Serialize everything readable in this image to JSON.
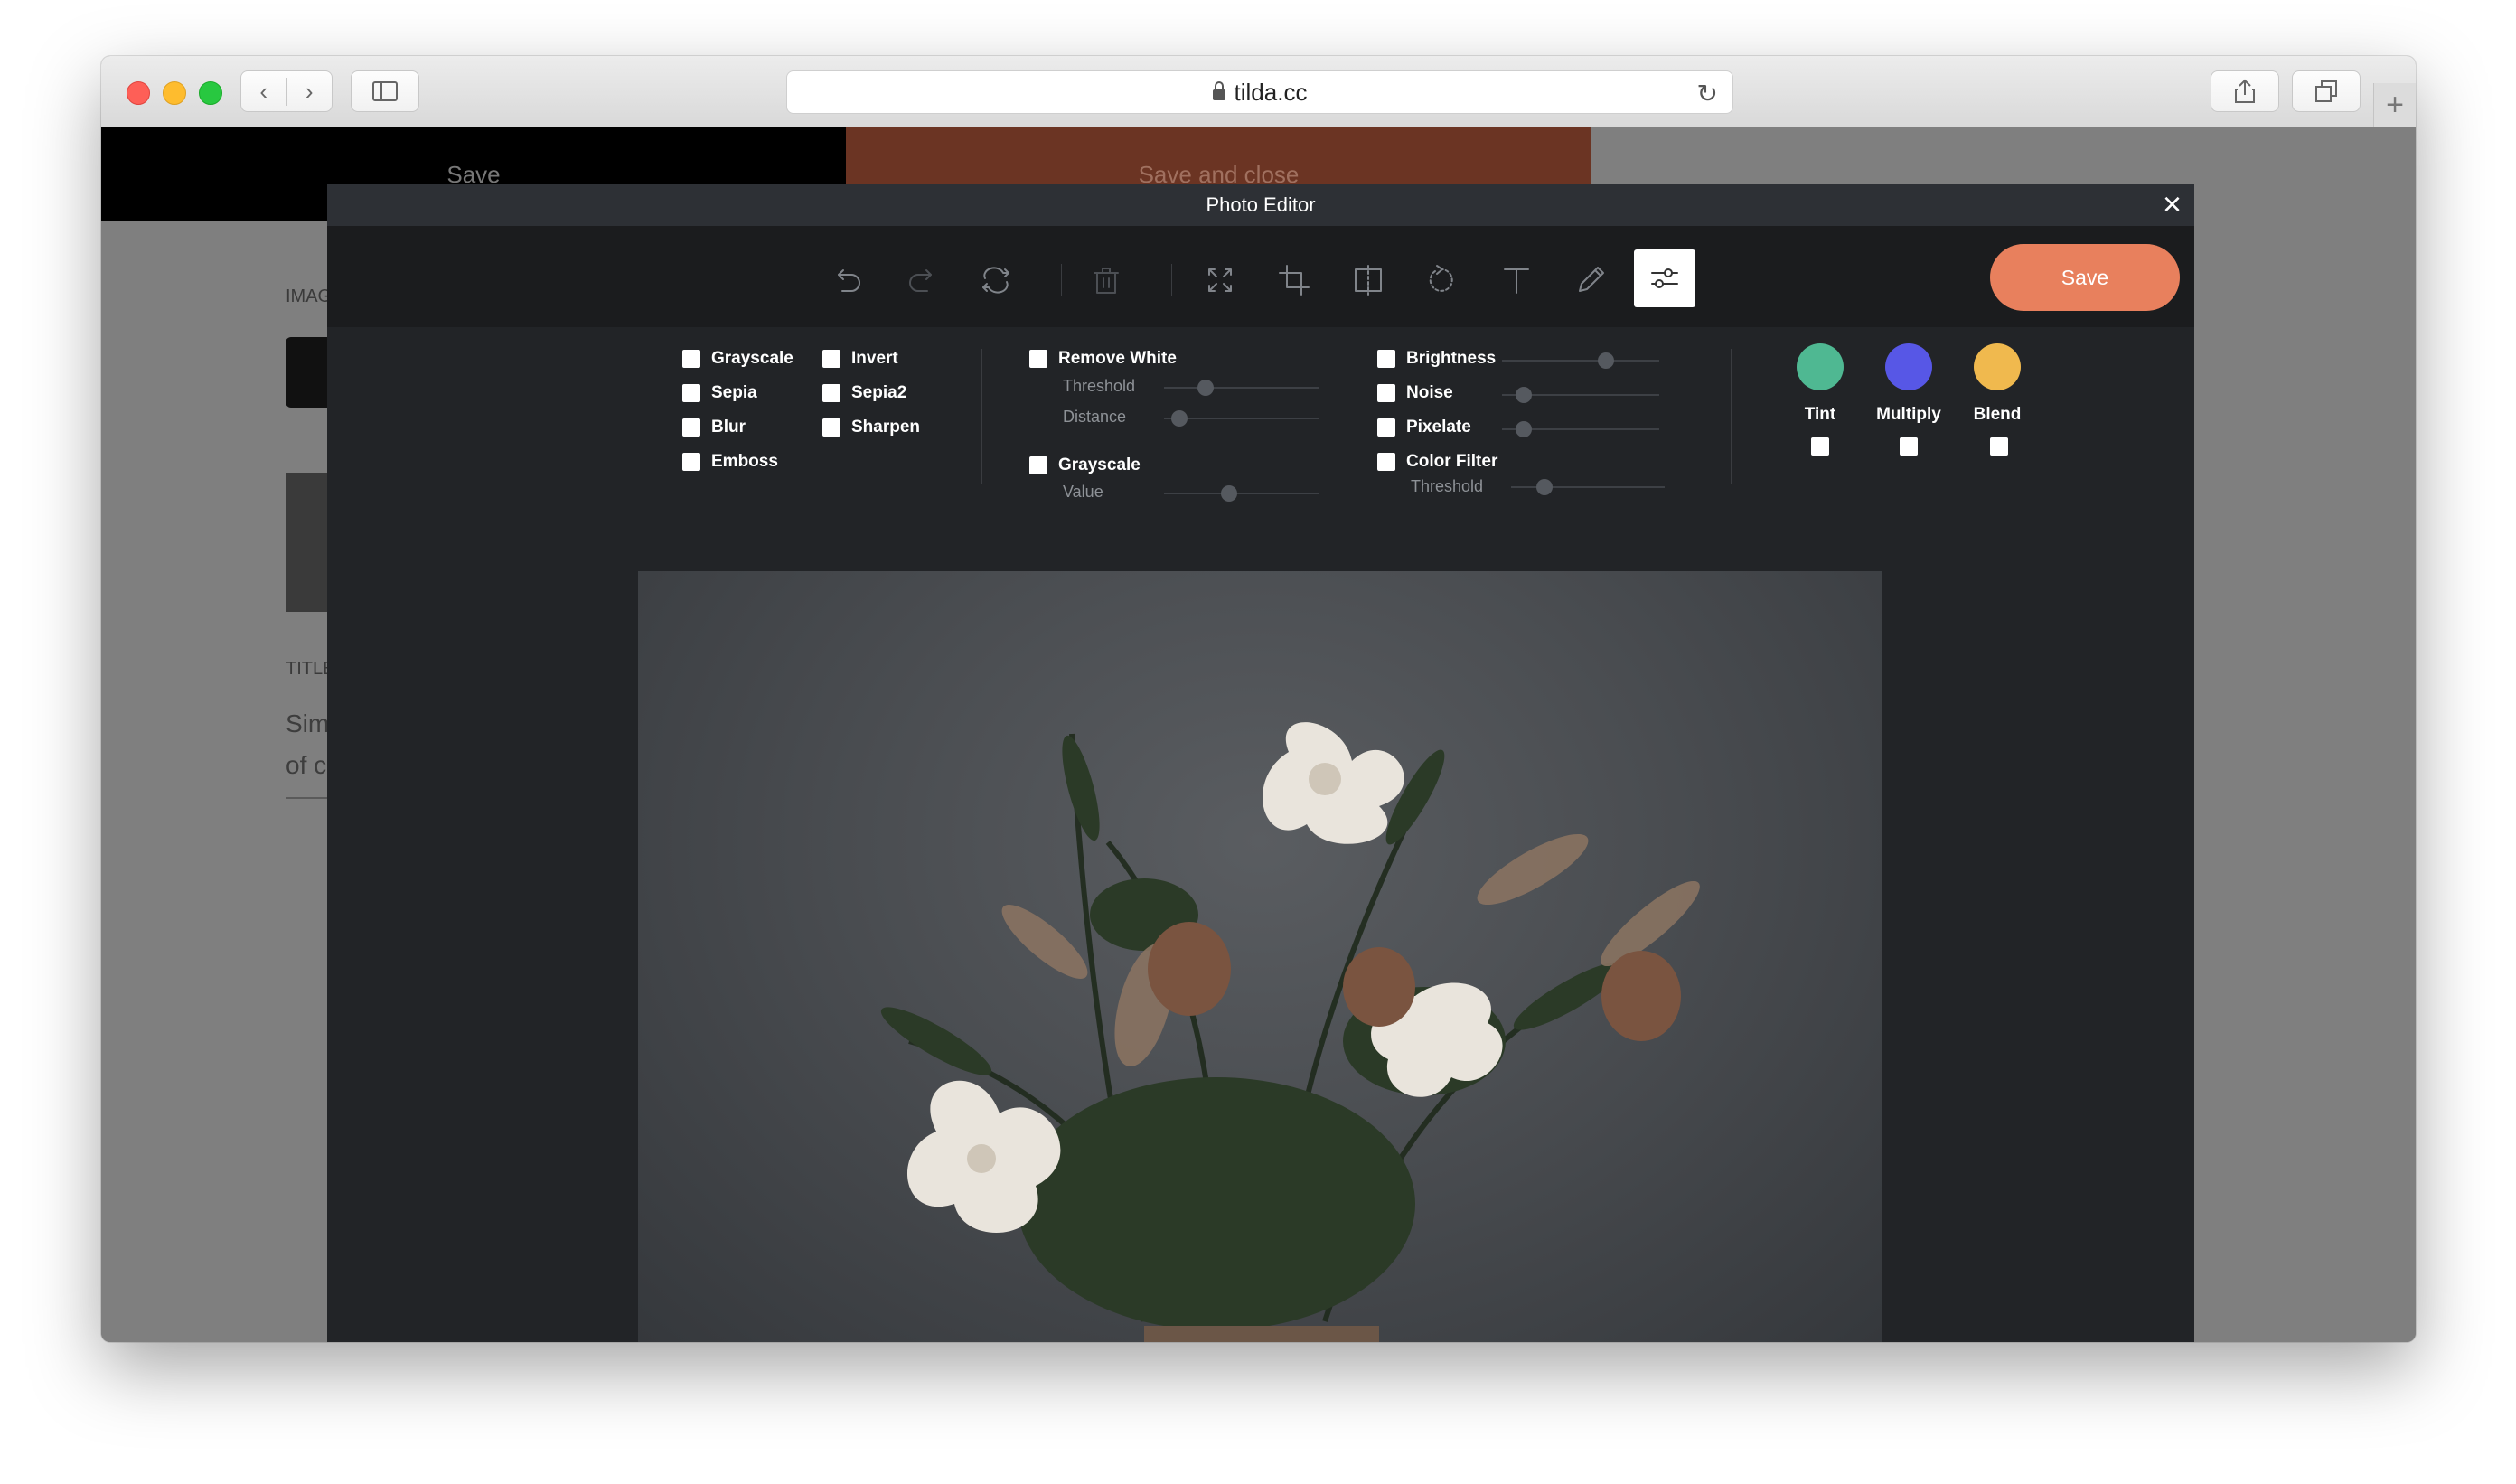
{
  "browser": {
    "url": "tilda.cc"
  },
  "page": {
    "top_save": "Save",
    "top_save_close": "Save and close",
    "label_image": "IMAG",
    "label_title": "TITLE",
    "text_line1": "Sim",
    "text_line2": "of c"
  },
  "editor": {
    "title": "Photo Editor",
    "close_icon": "×",
    "save_label": "Save",
    "tools": [
      "undo-icon",
      "redo-icon",
      "reset-icon",
      "delete-icon",
      "fullscreen-icon",
      "crop-icon",
      "flip-icon",
      "rotate-icon",
      "text-icon",
      "draw-icon",
      "filters-icon"
    ],
    "filters_col1": [
      "Grayscale",
      "Sepia",
      "Blur",
      "Emboss"
    ],
    "filters_col2": [
      "Invert",
      "Sepia2",
      "Sharpen"
    ],
    "remove_white": {
      "label": "Remove White",
      "threshold_label": "Threshold",
      "distance_label": "Distance",
      "threshold_value": 0.27,
      "distance_value": 0.1
    },
    "grayscale": {
      "label": "Grayscale",
      "value_label": "Value",
      "value": 0.42
    },
    "brightness": {
      "label": "Brightness",
      "value": 0.66
    },
    "noise": {
      "label": "Noise",
      "value": 0.14
    },
    "pixelate": {
      "label": "Pixelate",
      "value": 0.14
    },
    "color_filter": {
      "label": "Color Filter",
      "threshold_label": "Threshold",
      "value": 0.22
    },
    "blends": [
      {
        "label": "Tint",
        "color": "#4fb892"
      },
      {
        "label": "Multiply",
        "color": "#5757e6"
      },
      {
        "label": "Blend",
        "color": "#f0b94e"
      }
    ],
    "accent_color": "#e8805d"
  }
}
